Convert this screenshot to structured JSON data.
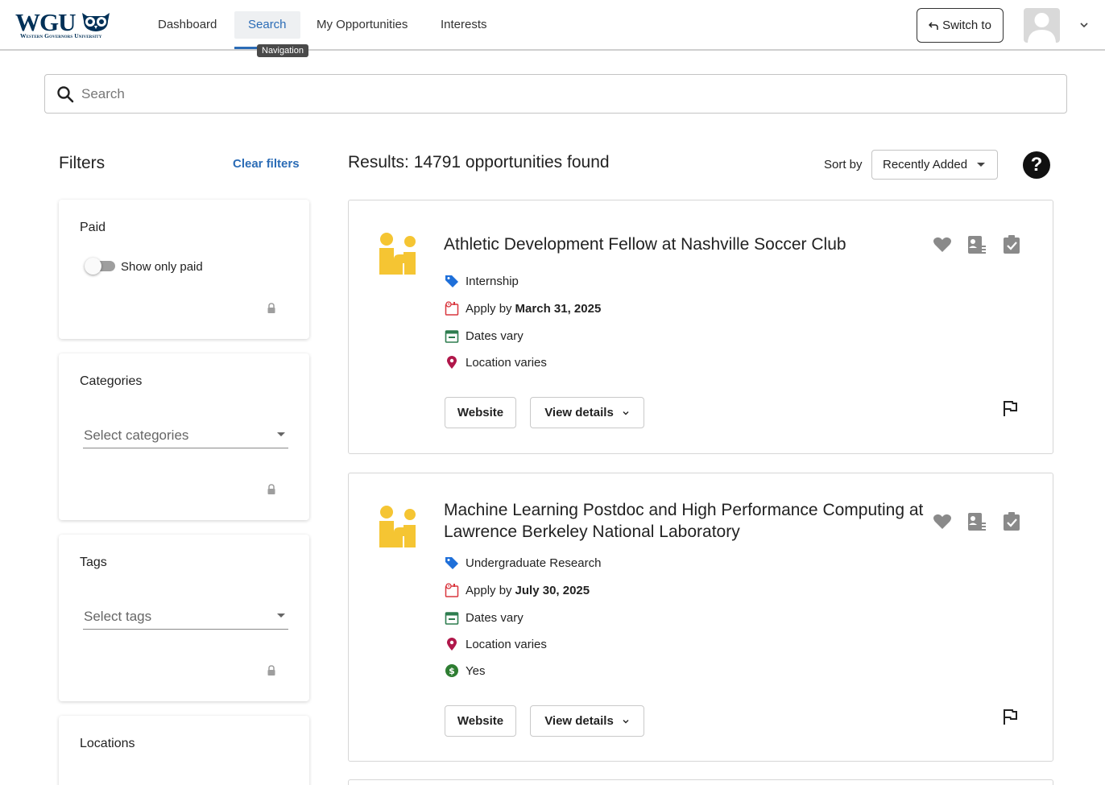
{
  "brand": {
    "logo_text": "WGU",
    "logo_subtitle": "Western Governors University"
  },
  "nav": {
    "items": [
      {
        "label": "Dashboard"
      },
      {
        "label": "Search",
        "active": true
      },
      {
        "label": "My Opportunities"
      },
      {
        "label": "Interests"
      }
    ],
    "tooltip": "Navigation",
    "switch_label": "Switch to"
  },
  "search": {
    "placeholder": "Search",
    "value": ""
  },
  "filters": {
    "title": "Filters",
    "clear_label": "Clear filters",
    "paid": {
      "title": "Paid",
      "toggle_label": "Show only paid",
      "toggle_on": false
    },
    "categories": {
      "title": "Categories",
      "placeholder": "Select categories"
    },
    "tags": {
      "title": "Tags",
      "placeholder": "Select tags"
    },
    "locations": {
      "title": "Locations"
    }
  },
  "results": {
    "title": "Results: 14791 opportunities found",
    "sort_label": "Sort by",
    "sort_value": "Recently Added",
    "help_label": "?"
  },
  "cards": [
    {
      "title": "Athletic Development Fellow at Nashville Soccer Club",
      "type": "Internship",
      "apply_prefix": "Apply by",
      "apply_date": "March 31, 2025",
      "dates": "Dates vary",
      "location": "Location varies",
      "website_label": "Website",
      "details_label": "View details"
    },
    {
      "title": "Machine Learning Postdoc and High Performance Computing at Lawrence Berkeley National Laboratory",
      "type": "Undergraduate Research",
      "apply_prefix": "Apply by",
      "apply_date": "July 30, 2025",
      "dates": "Dates vary",
      "location": "Location varies",
      "paid": "Yes",
      "website_label": "Website",
      "details_label": "View details"
    }
  ],
  "colors": {
    "accent": "#2b6cb6",
    "brand_navy": "#003057",
    "handshake_yellow": "#f5c533",
    "tag_blue": "#1e6fd9",
    "apply_red": "#d9363e",
    "dates_green": "#2e7d4f",
    "location_magenta": "#b0174a",
    "paid_green": "#2e7d32"
  }
}
